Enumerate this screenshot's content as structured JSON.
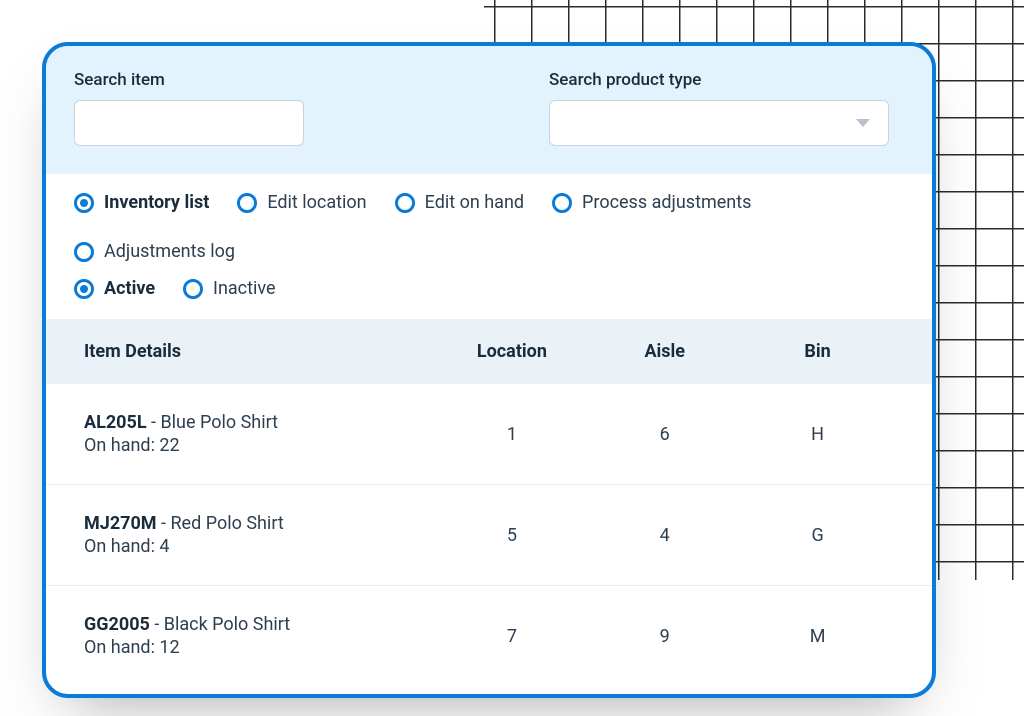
{
  "search": {
    "item_label": "Search item",
    "item_value": "",
    "type_label": "Search product type",
    "type_value": ""
  },
  "filters": {
    "row1": [
      {
        "label": "Inventory list",
        "selected": true
      },
      {
        "label": "Edit location",
        "selected": false
      },
      {
        "label": "Edit on hand",
        "selected": false
      },
      {
        "label": "Process adjustments",
        "selected": false
      },
      {
        "label": "Adjustments log",
        "selected": false
      }
    ],
    "row2": [
      {
        "label": "Active",
        "selected": true
      },
      {
        "label": "Inactive",
        "selected": false
      }
    ]
  },
  "table": {
    "headers": {
      "item": "Item Details",
      "location": "Location",
      "aisle": "Aisle",
      "bin": "Bin"
    },
    "on_hand_prefix": "On hand: ",
    "rows": [
      {
        "sku": "AL205L",
        "name": "Blue Polo Shirt",
        "on_hand": 22,
        "location": "1",
        "aisle": "6",
        "bin": "H"
      },
      {
        "sku": "MJ270M",
        "name": "Red Polo Shirt",
        "on_hand": 4,
        "location": "5",
        "aisle": "4",
        "bin": "G"
      },
      {
        "sku": "GG2005",
        "name": "Black Polo Shirt",
        "on_hand": 12,
        "location": "7",
        "aisle": "9",
        "bin": "M"
      }
    ]
  }
}
